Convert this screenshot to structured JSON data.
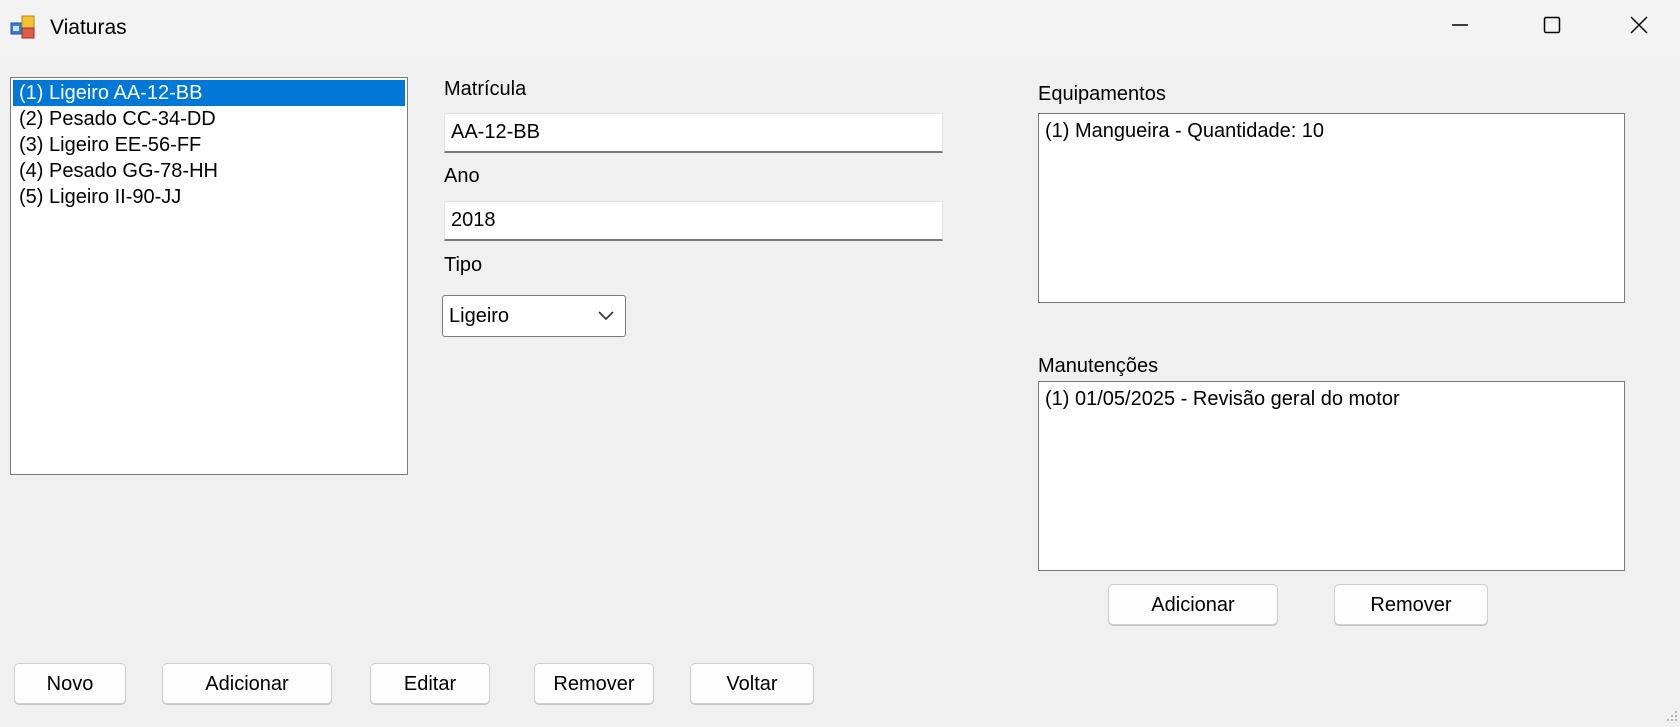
{
  "window": {
    "title": "Viaturas"
  },
  "vehicles": {
    "items": [
      {
        "label": "(1) Ligeiro AA-12-BB",
        "selected": true
      },
      {
        "label": "(2) Pesado CC-34-DD",
        "selected": false
      },
      {
        "label": "(3) Ligeiro EE-56-FF",
        "selected": false
      },
      {
        "label": "(4) Pesado GG-78-HH",
        "selected": false
      },
      {
        "label": "(5) Ligeiro II-90-JJ",
        "selected": false
      }
    ]
  },
  "form": {
    "matricula_label": "Matrícula",
    "matricula_value": "AA-12-BB",
    "ano_label": "Ano",
    "ano_value": "2018",
    "tipo_label": "Tipo",
    "tipo_value": "Ligeiro"
  },
  "equipamentos": {
    "label": "Equipamentos",
    "items": [
      "(1) Mangueira - Quantidade: 10"
    ]
  },
  "manutencoes": {
    "label": "Manutenções",
    "items": [
      "(1) 01/05/2025 - Revisão geral do motor"
    ],
    "add_label": "Adicionar",
    "remove_label": "Remover"
  },
  "bottom_buttons": {
    "novo": "Novo",
    "adicionar": "Adicionar",
    "editar": "Editar",
    "remover": "Remover",
    "voltar": "Voltar"
  },
  "colors": {
    "selection": "#0078d7",
    "background": "#f0f0f0"
  },
  "icons": {
    "app": "app-icon",
    "minimize": "minimize-icon",
    "maximize": "maximize-icon",
    "close": "close-icon",
    "dropdown": "chevron-down-icon",
    "grip": "resize-grip-icon"
  }
}
